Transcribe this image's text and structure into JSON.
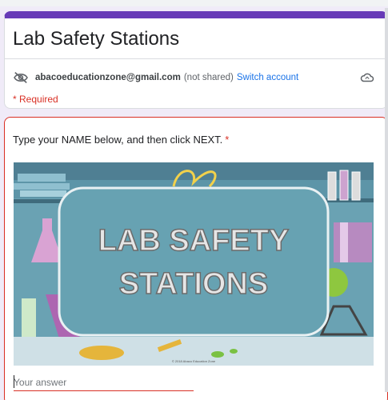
{
  "form": {
    "title": "Lab Safety Stations",
    "account": {
      "email": "abacoeducationzone@gmail.com",
      "not_shared": "(not shared)",
      "switch_label": "Switch account"
    },
    "required_note": "* Required",
    "question": {
      "text": "Type your NAME below, and then click NEXT.",
      "required_mark": "*",
      "image_title_line1": "LAB SAFETY",
      "image_title_line2": "STATIONS",
      "image_credit": "© 2018 Abaco Education Zone",
      "answer_placeholder": "Your answer"
    }
  },
  "colors": {
    "accent": "#673ab7",
    "error": "#d93025",
    "link": "#1a73e8"
  },
  "icons": [
    "visibility-off-icon",
    "cloud-icon"
  ]
}
